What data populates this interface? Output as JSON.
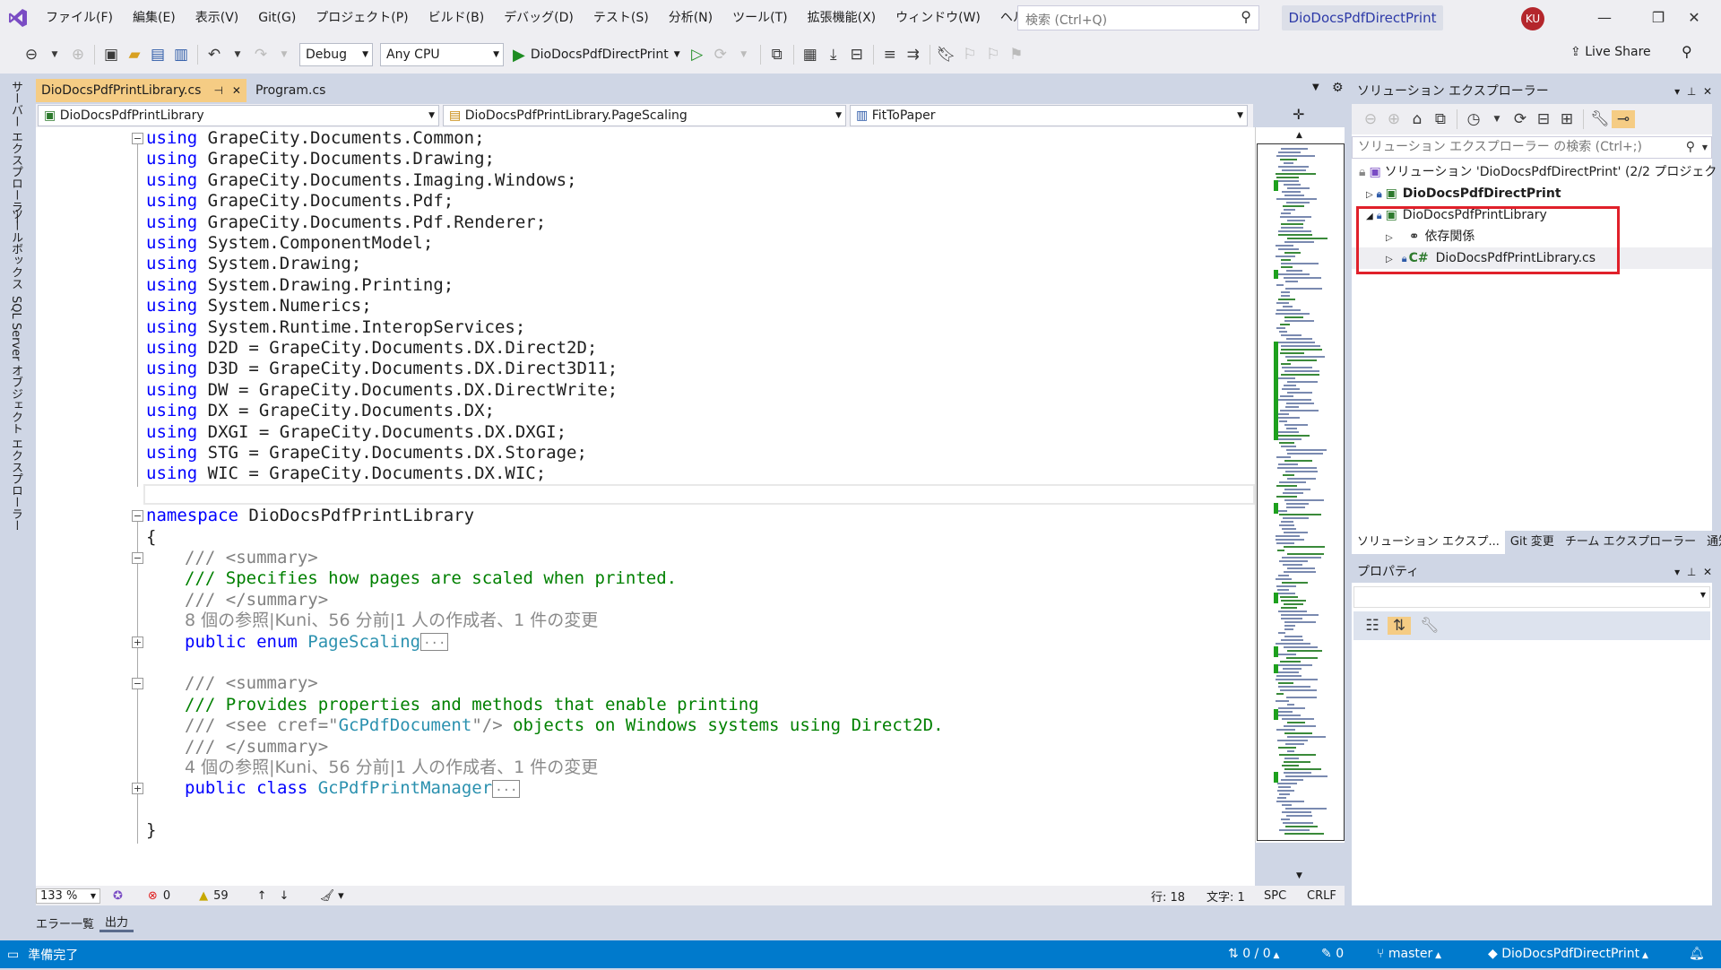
{
  "menu": [
    "ファイル(F)",
    "編集(E)",
    "表示(V)",
    "Git(G)",
    "プロジェクト(P)",
    "ビルド(B)",
    "デバッグ(D)",
    "テスト(S)",
    "分析(N)",
    "ツール(T)",
    "拡張機能(X)",
    "ウィンドウ(W)",
    "ヘルプ(H)"
  ],
  "search": {
    "placeholder": "検索 (Ctrl+Q)"
  },
  "solution_title": "DioDocsPdfDirectPrint",
  "user_initials": "KU",
  "toolbar": {
    "config": "Debug",
    "platform": "Any CPU",
    "start_label": "DioDocsPdfDirectPrint",
    "live_share": "Live Share"
  },
  "left_rail": [
    "サーバー エクスプローラー",
    "ツールボックス",
    "SQL Server オブジェクト エクスプローラー"
  ],
  "doc_tabs": [
    {
      "label": "DioDocsPdfPrintLibrary.cs",
      "active": true
    },
    {
      "label": "Program.cs",
      "active": false
    }
  ],
  "nav": {
    "project": "DioDocsPdfPrintLibrary",
    "type": "DioDocsPdfPrintLibrary.PageScaling",
    "member": "FitToPaper"
  },
  "code": {
    "usings": [
      "GrapeCity.Documents.Common;",
      "GrapeCity.Documents.Drawing;",
      "GrapeCity.Documents.Imaging.Windows;",
      "GrapeCity.Documents.Pdf;",
      "GrapeCity.Documents.Pdf.Renderer;",
      "System.ComponentModel;",
      "System.Drawing;",
      "System.Drawing.Printing;",
      "System.Numerics;",
      "System.Runtime.InteropServices;",
      "D2D = GrapeCity.Documents.DX.Direct2D;",
      "D3D = GrapeCity.Documents.DX.Direct3D11;",
      "DW = GrapeCity.Documents.DX.DirectWrite;",
      "DX = GrapeCity.Documents.DX;",
      "DXGI = GrapeCity.Documents.DX.DXGI;",
      "STG = GrapeCity.Documents.DX.Storage;",
      "WIC = GrapeCity.Documents.DX.WIC;"
    ],
    "using_kw": "using",
    "namespace_kw": "namespace",
    "namespace_name": "DioDocsPdfPrintLibrary",
    "open_brace": "{",
    "close_brace": "}",
    "summary_open": "/// <summary>",
    "summary_close": "/// </summary>",
    "enum_comment": "/// Specifies how pages are scaled when printed.",
    "enum_lens": "8 個の参照|Kuni、56 分前|1 人の作成者、1 件の変更",
    "enum_kw": "public enum ",
    "enum_name": "PageScaling",
    "class_comment1": "/// Provides properties and methods that enable printing",
    "class_comment2_pre": "/// <see cref=\"",
    "class_comment2_ref": "GcPdfDocument",
    "class_comment2_mid": "\"/> ",
    "class_comment2_post": "objects on Windows systems using Direct2D.",
    "class_lens": "4 個の参照|Kuni、56 分前|1 人の作成者、1 件の変更",
    "class_kw": "public class ",
    "class_name": "GcPdfPrintManager",
    "ellipsis": "..."
  },
  "editor_status": {
    "zoom": "133 %",
    "errors": "0",
    "warnings": "59",
    "line": "行: 18",
    "col": "文字: 1",
    "spc": "SPC",
    "eol": "CRLF"
  },
  "bottom_tabs": [
    "エラー一覧",
    "出力"
  ],
  "status": {
    "ready": "準備完了",
    "commits": "0 / 0",
    "pending": "0",
    "branch": "master",
    "repo": "DioDocsPdfDirectPrint"
  },
  "solution_explorer": {
    "title": "ソリューション エクスプローラー",
    "search_placeholder": "ソリューション エクスプローラー の検索 (Ctrl+;)",
    "items": [
      {
        "label": "ソリューション 'DioDocsPdfDirectPrint' (2/2 プロジェクト)"
      },
      {
        "label": "DioDocsPdfDirectPrint"
      },
      {
        "label": "DioDocsPdfPrintLibrary"
      },
      {
        "label": "依存関係"
      },
      {
        "label": "DioDocsPdfPrintLibrary.cs"
      }
    ],
    "tabs": [
      "ソリューション エクスプ...",
      "Git 変更",
      "チーム エクスプローラー",
      "通知"
    ]
  },
  "properties": {
    "title": "プロパティ"
  },
  "accent": "#007acc",
  "highlight_color": "#e0202a"
}
